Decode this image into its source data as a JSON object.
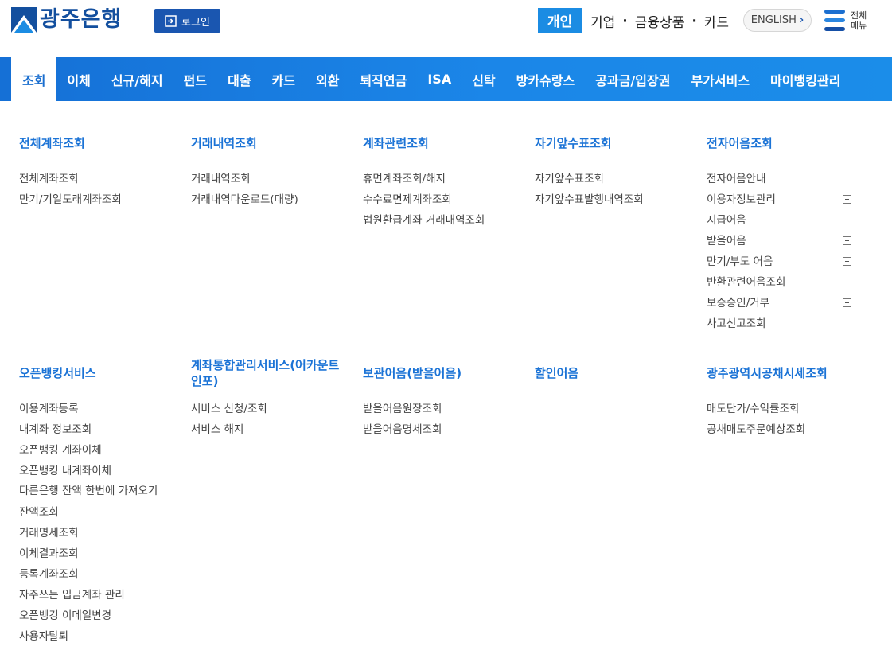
{
  "header": {
    "logo_text": "광주은행",
    "login_label": "로그인",
    "personal_label": "개인",
    "links": [
      "기업",
      "금융상품",
      "카드"
    ],
    "english_label": "ENGLISH",
    "allmenu_line1": "전체",
    "allmenu_line2": "메뉴",
    "brand_color": "#134f9e",
    "accent_color": "#1b8ce3"
  },
  "nav": {
    "items": [
      "조회",
      "이체",
      "신규/해지",
      "펀드",
      "대출",
      "카드",
      "외환",
      "퇴직연금",
      "ISA",
      "신탁",
      "방카슈랑스",
      "공과금/입장권",
      "부가서비스",
      "마이뱅킹관리"
    ],
    "active": "조회"
  },
  "menu": {
    "row1": [
      {
        "title": "전체계좌조회",
        "items": [
          "전체계좌조회",
          "만기/기일도래계좌조회"
        ]
      },
      {
        "title": "거래내역조회",
        "items": [
          "거래내역조회",
          "거래내역다운로드(대량)"
        ]
      },
      {
        "title": "계좌관련조회",
        "items": [
          "휴면계좌조회/해지",
          "수수료면제계좌조회",
          "법원환급계좌 거래내역조회"
        ]
      },
      {
        "title": "자기앞수표조회",
        "items": [
          "자기앞수표조회",
          "자기앞수표발행내역조회"
        ]
      },
      {
        "title": "전자어음조회",
        "items": [
          "전자어음안내",
          "이용자정보관리",
          "지급어음",
          "받을어음",
          "만기/부도 어음",
          "반환관련어음조회",
          "보증승인/거부",
          "사고신고조회"
        ]
      }
    ],
    "row2": [
      {
        "title": "오픈뱅킹서비스",
        "items": [
          "이용계좌등록",
          "내계좌 정보조회",
          "오픈뱅킹 계좌이체",
          "오픈뱅킹 내계좌이체",
          "다른은행 잔액 한번에 가져오기",
          "잔액조회",
          "거래명세조회",
          "이체결과조회",
          "등록계좌조회",
          "자주쓰는 입금계좌 관리",
          "오픈뱅킹 이메일변경",
          "사용자탈퇴"
        ]
      },
      {
        "title": "계좌통합관리서비스(어카운트인포)",
        "items": [
          "서비스 신청/조회",
          "서비스 해지"
        ]
      },
      {
        "title": "보관어음(받을어음)",
        "items": [
          "받을어음원장조회",
          "받을어음명세조회"
        ]
      },
      {
        "title": "할인어음",
        "items": []
      },
      {
        "title": "광주광역시공채시세조회",
        "items": [
          "매도단가/수익률조회",
          "공채매도주문예상조회"
        ]
      }
    ]
  }
}
